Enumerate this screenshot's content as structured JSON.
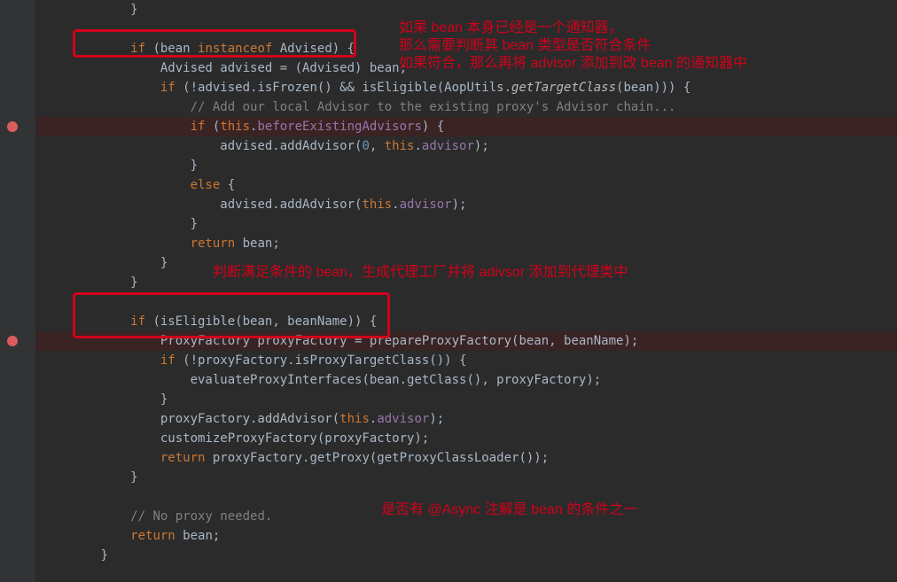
{
  "code_lines": [
    {
      "indent": 3,
      "bp": false,
      "tokens": [
        {
          "t": "}",
          "c": "punct"
        }
      ]
    },
    {
      "indent": 0,
      "bp": false,
      "tokens": []
    },
    {
      "indent": 3,
      "bp": false,
      "tokens": [
        {
          "t": "if ",
          "c": "kw"
        },
        {
          "t": "(bean ",
          "c": "ident"
        },
        {
          "t": "instanceof ",
          "c": "kw"
        },
        {
          "t": "Advised) {",
          "c": "ident"
        }
      ]
    },
    {
      "indent": 4,
      "bp": false,
      "tokens": [
        {
          "t": "Advised advised = (Advised) bean",
          "c": "ident"
        },
        {
          "t": ";",
          "c": "punct"
        }
      ]
    },
    {
      "indent": 4,
      "bp": false,
      "tokens": [
        {
          "t": "if ",
          "c": "kw"
        },
        {
          "t": "(!advised.isFrozen() && isEligible(AopUtils.",
          "c": "ident"
        },
        {
          "t": "getTargetClass",
          "c": "static"
        },
        {
          "t": "(bean))) {",
          "c": "ident"
        }
      ]
    },
    {
      "indent": 5,
      "bp": false,
      "tokens": [
        {
          "t": "// Add our local Advisor to the existing proxy's Advisor chain...",
          "c": "comment"
        }
      ]
    },
    {
      "indent": 5,
      "bp": true,
      "tokens": [
        {
          "t": "if ",
          "c": "kw"
        },
        {
          "t": "(",
          "c": "punct"
        },
        {
          "t": "this",
          "c": "kw"
        },
        {
          "t": ".",
          "c": "punct"
        },
        {
          "t": "beforeExistingAdvisors",
          "c": "field"
        },
        {
          "t": ") {",
          "c": "punct"
        }
      ]
    },
    {
      "indent": 6,
      "bp": false,
      "tokens": [
        {
          "t": "advised.addAdvisor(",
          "c": "ident"
        },
        {
          "t": "0",
          "c": "num"
        },
        {
          "t": ", ",
          "c": "punct"
        },
        {
          "t": "this",
          "c": "kw"
        },
        {
          "t": ".",
          "c": "punct"
        },
        {
          "t": "advisor",
          "c": "field"
        },
        {
          "t": ");",
          "c": "punct"
        }
      ]
    },
    {
      "indent": 5,
      "bp": false,
      "tokens": [
        {
          "t": "}",
          "c": "punct"
        }
      ]
    },
    {
      "indent": 5,
      "bp": false,
      "tokens": [
        {
          "t": "else ",
          "c": "kw"
        },
        {
          "t": "{",
          "c": "punct"
        }
      ]
    },
    {
      "indent": 6,
      "bp": false,
      "tokens": [
        {
          "t": "advised.addAdvisor(",
          "c": "ident"
        },
        {
          "t": "this",
          "c": "kw"
        },
        {
          "t": ".",
          "c": "punct"
        },
        {
          "t": "advisor",
          "c": "field"
        },
        {
          "t": ");",
          "c": "punct"
        }
      ]
    },
    {
      "indent": 5,
      "bp": false,
      "tokens": [
        {
          "t": "}",
          "c": "punct"
        }
      ]
    },
    {
      "indent": 5,
      "bp": false,
      "tokens": [
        {
          "t": "return ",
          "c": "kw"
        },
        {
          "t": "bean",
          "c": "ident"
        },
        {
          "t": ";",
          "c": "punct"
        }
      ]
    },
    {
      "indent": 4,
      "bp": false,
      "tokens": [
        {
          "t": "}",
          "c": "punct"
        }
      ]
    },
    {
      "indent": 3,
      "bp": false,
      "tokens": [
        {
          "t": "}",
          "c": "punct"
        }
      ]
    },
    {
      "indent": 0,
      "bp": false,
      "tokens": []
    },
    {
      "indent": 3,
      "bp": false,
      "tokens": [
        {
          "t": "if ",
          "c": "kw"
        },
        {
          "t": "(isEligible(bean",
          "c": "ident"
        },
        {
          "t": ", ",
          "c": "punct"
        },
        {
          "t": "beanName)) {",
          "c": "ident"
        }
      ]
    },
    {
      "indent": 4,
      "bp": true,
      "tokens": [
        {
          "t": "ProxyFactory proxyFactory = prepareProxyFactory(bean",
          "c": "ident"
        },
        {
          "t": ", ",
          "c": "punct"
        },
        {
          "t": "beanName)",
          "c": "ident"
        },
        {
          "t": ";",
          "c": "punct"
        }
      ]
    },
    {
      "indent": 4,
      "bp": false,
      "tokens": [
        {
          "t": "if ",
          "c": "kw"
        },
        {
          "t": "(!proxyFactory.isProxyTargetClass()) {",
          "c": "ident"
        }
      ]
    },
    {
      "indent": 5,
      "bp": false,
      "tokens": [
        {
          "t": "evaluateProxyInterfaces(bean.getClass()",
          "c": "ident"
        },
        {
          "t": ", ",
          "c": "punct"
        },
        {
          "t": "proxyFactory)",
          "c": "ident"
        },
        {
          "t": ";",
          "c": "punct"
        }
      ]
    },
    {
      "indent": 4,
      "bp": false,
      "tokens": [
        {
          "t": "}",
          "c": "punct"
        }
      ]
    },
    {
      "indent": 4,
      "bp": false,
      "tokens": [
        {
          "t": "proxyFactory.addAdvisor(",
          "c": "ident"
        },
        {
          "t": "this",
          "c": "kw"
        },
        {
          "t": ".",
          "c": "punct"
        },
        {
          "t": "advisor",
          "c": "field"
        },
        {
          "t": ");",
          "c": "punct"
        }
      ]
    },
    {
      "indent": 4,
      "bp": false,
      "tokens": [
        {
          "t": "customizeProxyFactory(proxyFactory)",
          "c": "ident"
        },
        {
          "t": ";",
          "c": "punct"
        }
      ]
    },
    {
      "indent": 4,
      "bp": false,
      "tokens": [
        {
          "t": "return ",
          "c": "kw"
        },
        {
          "t": "proxyFactory.getProxy(getProxyClassLoader())",
          "c": "ident"
        },
        {
          "t": ";",
          "c": "punct"
        }
      ]
    },
    {
      "indent": 3,
      "bp": false,
      "tokens": [
        {
          "t": "}",
          "c": "punct"
        }
      ]
    },
    {
      "indent": 0,
      "bp": false,
      "tokens": []
    },
    {
      "indent": 3,
      "bp": false,
      "tokens": [
        {
          "t": "// No proxy needed.",
          "c": "comment"
        }
      ]
    },
    {
      "indent": 3,
      "bp": false,
      "tokens": [
        {
          "t": "return ",
          "c": "kw"
        },
        {
          "t": "bean",
          "c": "ident"
        },
        {
          "t": ";",
          "c": "punct"
        }
      ]
    },
    {
      "indent": 2,
      "bp": false,
      "tokens": [
        {
          "t": "}",
          "c": "punct"
        }
      ]
    }
  ],
  "annotations": {
    "a1_l1": "如果 bean 本身已经是一个通知器，",
    "a1_l2": "那么需要判断其 bean 类型是否符合条件",
    "a1_l3": "如果符合，那么再将 advisor 添加到改 bean 的通知器中",
    "a2": "判断满足条件的 bean，生成代理工厂并将 adivsor 添加到代理类中",
    "a3": "是否有 @Async 注解是 bean 的条件之一"
  },
  "colors": {
    "highlight": "#d0021b",
    "editor_bg": "#2b2b2b"
  }
}
